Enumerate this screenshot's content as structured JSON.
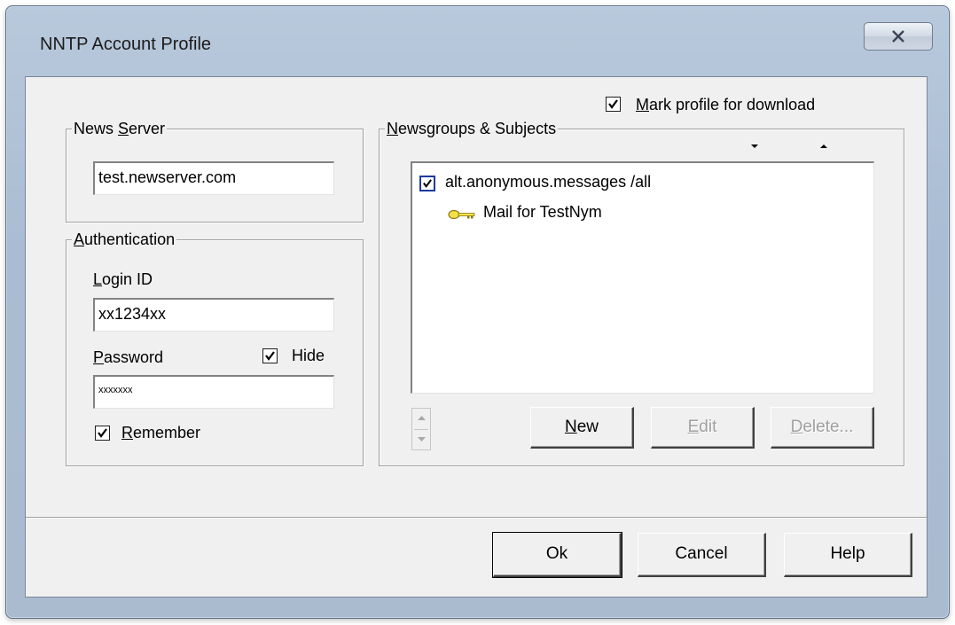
{
  "window": {
    "title": "NNTP Account Profile",
    "close_icon": "close-x-icon"
  },
  "header": {
    "mark_profile": {
      "label": "Mark profile for download",
      "checked": true
    }
  },
  "news_server": {
    "legend": "News Server",
    "value": "test.newserver.com"
  },
  "authentication": {
    "legend": "Authentication",
    "login_label": "Login ID",
    "login_value": "xx1234xx",
    "password_label": "Password",
    "password_value": "xxxxxxx",
    "hide": {
      "label": "Hide",
      "checked": true
    },
    "remember": {
      "label": "Remember",
      "checked": true
    }
  },
  "newsgroups": {
    "legend": "Newsgroups & Subjects",
    "sort_down_icon": "arrow-down-icon",
    "sort_up_icon": "arrow-up-icon",
    "items": [
      {
        "label": "alt.anonymous.messages /all",
        "checked": true
      },
      {
        "label": "Mail for TestNym",
        "icon": "key-icon"
      }
    ],
    "buttons": {
      "new": "New",
      "edit": "Edit",
      "delete": "Delete..."
    }
  },
  "footer": {
    "ok": "Ok",
    "cancel": "Cancel",
    "help": "Help"
  }
}
